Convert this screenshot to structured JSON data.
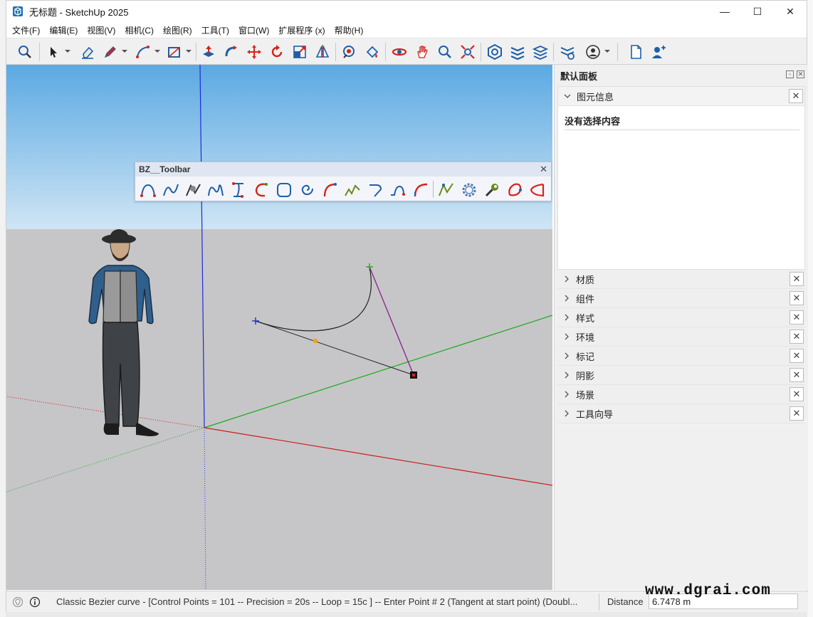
{
  "window": {
    "title": "无标题 - SketchUp 2025",
    "controls": {
      "minimize": "—",
      "maximize": "☐",
      "close": "✕"
    }
  },
  "menu": [
    "文件(F)",
    "编辑(E)",
    "视图(V)",
    "相机(C)",
    "绘图(R)",
    "工具(T)",
    "窗口(W)",
    "扩展程序 (x)",
    "帮助(H)"
  ],
  "colors": {
    "sky_top": "#5ba9e3",
    "sky_bottom": "#cfe5f4",
    "ground": "#c6c6c8",
    "axis_blue": "#1e2ad8",
    "axis_green": "#1aaa1a",
    "axis_red": "#c81e1e",
    "control_line": "#8b1e8b",
    "accent_red": "#d4241c"
  },
  "bz_toolbar": {
    "title": "BZ__Toolbar",
    "close": "✕"
  },
  "tray": {
    "title": "默认面板",
    "pin": "▫",
    "close": "✕",
    "entity_info": {
      "label": "图元信息",
      "close": "✕",
      "empty_text": "没有选择内容"
    },
    "sections": [
      {
        "label": "材质",
        "close": "✕"
      },
      {
        "label": "组件",
        "close": "✕"
      },
      {
        "label": "样式",
        "close": "✕"
      },
      {
        "label": "环境",
        "close": "✕"
      },
      {
        "label": "标记",
        "close": "✕"
      },
      {
        "label": "阴影",
        "close": "✕"
      },
      {
        "label": "场景",
        "close": "✕"
      },
      {
        "label": "工具向导",
        "close": "✕"
      }
    ]
  },
  "status": {
    "message": "Classic Bezier curve - [Control Points = 101  -- Precision = 20s  -- Loop = 15c ]  -- Enter Point # 2 (Tangent at start point)  (Doubl...",
    "distance_label": "Distance",
    "distance_value": "6.7478 m"
  },
  "watermark": "www.dgrai.com"
}
